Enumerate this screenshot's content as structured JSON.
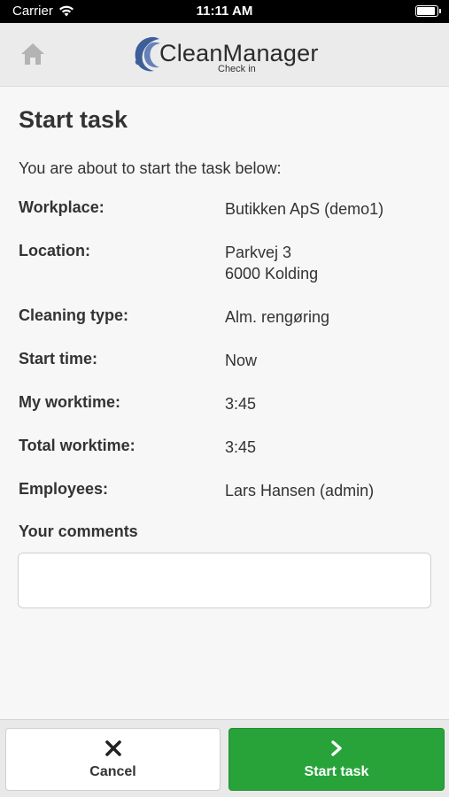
{
  "status_bar": {
    "carrier": "Carrier",
    "time": "11:11 AM"
  },
  "header": {
    "app_name": "CleanManager",
    "subtitle": "Check in"
  },
  "page": {
    "title": "Start task",
    "intro": "You are about to start the task below:"
  },
  "details": [
    {
      "label": "Workplace:",
      "value": "Butikken ApS (demo1)"
    },
    {
      "label": "Location:",
      "value_line1": "Parkvej 3",
      "value_line2": "6000 Kolding"
    },
    {
      "label": "Cleaning type:",
      "value": "Alm. rengøring"
    },
    {
      "label": "Start time:",
      "value": "Now"
    },
    {
      "label": "My worktime:",
      "value": "3:45"
    },
    {
      "label": "Total worktime:",
      "value": "3:45"
    },
    {
      "label": "Employees:",
      "value": "Lars Hansen (admin)"
    }
  ],
  "comments": {
    "label": "Your comments",
    "value": "",
    "placeholder": ""
  },
  "footer": {
    "cancel_label": "Cancel",
    "start_label": "Start task",
    "start_color": "#27a33a"
  },
  "icons": [
    "wifi-icon",
    "battery-icon",
    "home-icon",
    "logo-icon",
    "close-icon",
    "chevron-right-icon"
  ]
}
